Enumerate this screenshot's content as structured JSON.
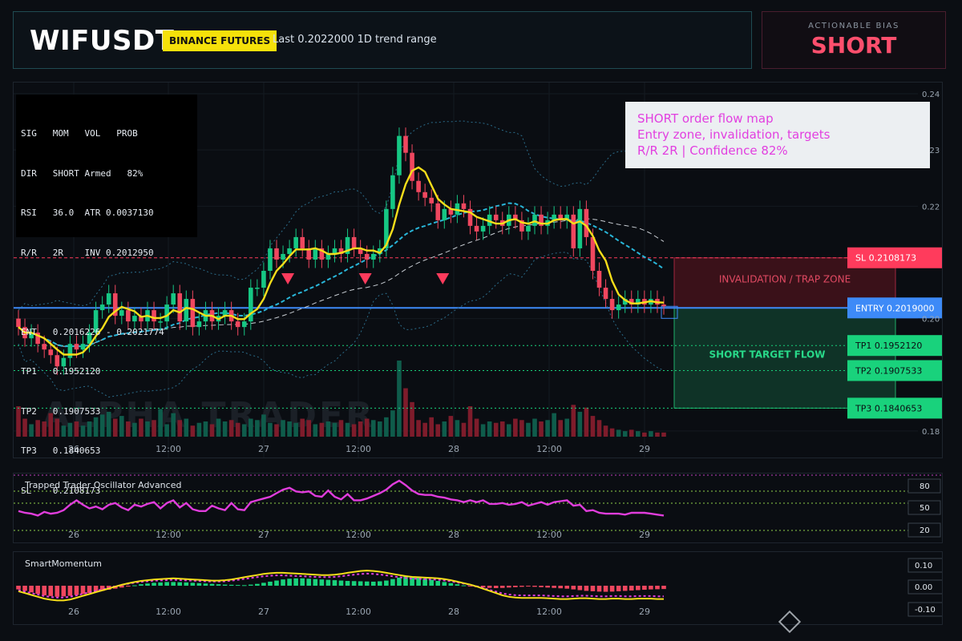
{
  "header": {
    "symbol": "WIFUSDT",
    "exchange_badge": "BINANCE FUTURES",
    "last_info": "Last 0.2022000   1D trend range"
  },
  "bias": {
    "label": "ACTIONABLE BIAS",
    "value": "SHORT"
  },
  "stats_panel": {
    "lines": [
      "SIG   MOM   VOL   PROB",
      "DIR   SHORT Armed   82%",
      "RSI   36.0  ATR 0.0037130",
      "R/R   2R    INV 0.2012950",
      "",
      "ENT   0.2016226 - 0.2021774",
      "TP1   0.1952120",
      "TP2   0.1907533",
      "TP3   0.1840653",
      "SL    0.2108173"
    ]
  },
  "note_box": {
    "lines": [
      "SHORT order flow map",
      "Entry zone, invalidation, targets",
      "R/R 2R | Confidence 82%"
    ]
  },
  "levels": [
    {
      "label": "SL 0.2108173",
      "value": 0.2108173,
      "color": "#ff3b5c",
      "text_color": "#ffffff"
    },
    {
      "label": "ENTRY 0.2019000",
      "value": 0.2019,
      "color": "#3d8af7",
      "text_color": "#ffffff"
    },
    {
      "label": "TP1 0.1952120",
      "value": 0.195212,
      "color": "#19d27c",
      "text_color": "#0b0e13"
    },
    {
      "label": "TP2 0.1907533",
      "value": 0.1907533,
      "color": "#19d27c",
      "text_color": "#0b0e13"
    },
    {
      "label": "TP3 0.1840653",
      "value": 0.1840653,
      "color": "#19d27c",
      "text_color": "#0b0e13"
    }
  ],
  "zones": {
    "invalidation": "INVALIDATION / TRAP ZONE",
    "target": "SHORT TARGET FLOW"
  },
  "watermark": "ALPHA TRADER",
  "chart_data": [
    {
      "type": "candlestick",
      "title": "WIFUSDT",
      "x_tick_labels": [
        "26",
        "12:00",
        "27",
        "12:00",
        "28",
        "12:00",
        "29"
      ],
      "ylim": [
        0.175,
        0.242
      ],
      "y_ticks": [
        0.18,
        0.2,
        0.22,
        0.23,
        0.24
      ],
      "y_tick_labels": [
        "0.18",
        "0.20",
        "0.22",
        "0.23",
        "0.24"
      ],
      "close": [
        0.1985,
        0.1965,
        0.1975,
        0.1955,
        0.1945,
        0.1935,
        0.1915,
        0.193,
        0.1955,
        0.1945,
        0.1955,
        0.1975,
        0.2015,
        0.2025,
        0.2045,
        0.2005,
        0.2015,
        0.1995,
        0.2005,
        0.1995,
        0.2015,
        0.1995,
        0.1995,
        0.2025,
        0.2045,
        0.1995,
        0.2035,
        0.1985,
        0.1995,
        0.2015,
        0.1995,
        0.2005,
        0.2015,
        0.1995,
        0.1985,
        0.1995,
        0.2055,
        0.2055,
        0.2085,
        0.2125,
        0.2105,
        0.2115,
        0.2125,
        0.2145,
        0.2125,
        0.2105,
        0.2125,
        0.2105,
        0.2115,
        0.2125,
        0.2115,
        0.2145,
        0.2125,
        0.2115,
        0.2105,
        0.2115,
        0.2125,
        0.2195,
        0.2255,
        0.2325,
        0.2295,
        0.2245,
        0.2225,
        0.2215,
        0.2205,
        0.2175,
        0.2195,
        0.2185,
        0.2205,
        0.2195,
        0.2165,
        0.2155,
        0.2165,
        0.2185,
        0.2175,
        0.2165,
        0.2185,
        0.2175,
        0.2155,
        0.2165,
        0.2185,
        0.2165,
        0.2175,
        0.2185,
        0.2175,
        0.2185,
        0.2125,
        0.2195,
        0.2145,
        0.2085,
        0.2055,
        0.2035,
        0.2015,
        0.2025,
        0.2035,
        0.2025,
        0.2035,
        0.2025,
        0.2035,
        0.2025,
        0.2022
      ],
      "open": [
        0.2,
        0.1985,
        0.1965,
        0.1975,
        0.1955,
        0.1945,
        0.1935,
        0.1915,
        0.193,
        0.1955,
        0.1945,
        0.1955,
        0.1975,
        0.2015,
        0.2025,
        0.2045,
        0.2005,
        0.2015,
        0.1995,
        0.2005,
        0.1995,
        0.2015,
        0.1995,
        0.1995,
        0.2025,
        0.2045,
        0.1995,
        0.2035,
        0.1985,
        0.1995,
        0.2015,
        0.1995,
        0.2005,
        0.2015,
        0.1995,
        0.1985,
        0.1995,
        0.2055,
        0.2055,
        0.2085,
        0.2125,
        0.2105,
        0.2115,
        0.2125,
        0.2145,
        0.2125,
        0.2105,
        0.2125,
        0.2105,
        0.2115,
        0.2125,
        0.2115,
        0.2145,
        0.2125,
        0.2115,
        0.2105,
        0.2115,
        0.2125,
        0.2195,
        0.2255,
        0.2325,
        0.2295,
        0.2245,
        0.2225,
        0.2215,
        0.2205,
        0.2175,
        0.2195,
        0.2185,
        0.2205,
        0.2195,
        0.2165,
        0.2155,
        0.2165,
        0.2185,
        0.2175,
        0.2165,
        0.2185,
        0.2175,
        0.2155,
        0.2165,
        0.2185,
        0.2165,
        0.2175,
        0.2185,
        0.2175,
        0.2185,
        0.2125,
        0.2195,
        0.2145,
        0.2085,
        0.2055,
        0.2035,
        0.2015,
        0.2025,
        0.2035,
        0.2025,
        0.2035,
        0.2025,
        0.2035,
        0.2025
      ],
      "volume": [
        22,
        13,
        9,
        12,
        11,
        17,
        13,
        8,
        10,
        11,
        8,
        11,
        14,
        16,
        18,
        13,
        15,
        11,
        10,
        13,
        11,
        12,
        20,
        9,
        17,
        12,
        13,
        8,
        10,
        11,
        9,
        13,
        11,
        12,
        10,
        9,
        13,
        12,
        16,
        10,
        9,
        12,
        11,
        10,
        13,
        12,
        9,
        10,
        11,
        10,
        12,
        10,
        9,
        11,
        13,
        12,
        11,
        14,
        19,
        55,
        35,
        25,
        12,
        10,
        14,
        9,
        11,
        15,
        12,
        10,
        22,
        13,
        9,
        11,
        10,
        11,
        9,
        13,
        12,
        10,
        13,
        11,
        12,
        17,
        12,
        13,
        23,
        18,
        21,
        15,
        12,
        8,
        6,
        5,
        4,
        5,
        4,
        3,
        4,
        3,
        3
      ]
    },
    {
      "type": "line",
      "title": "Trapped Trader Oscillator Advanced",
      "x_tick_labels": [
        "26",
        "12:00",
        "27",
        "12:00",
        "28",
        "12:00",
        "29"
      ],
      "y_tick_labels": [
        "80",
        "50",
        "20"
      ],
      "series": [
        {
          "values": [
            48,
            46,
            45,
            43,
            47,
            45,
            46,
            49,
            55,
            60,
            55,
            51,
            53,
            50,
            55,
            57,
            52,
            49,
            55,
            53,
            56,
            58,
            51,
            57,
            60,
            52,
            57,
            50,
            48,
            48,
            54,
            51,
            49,
            57,
            50,
            49,
            58,
            60,
            62,
            64,
            68,
            72,
            74,
            70,
            69,
            70,
            65,
            64,
            71,
            64,
            61,
            67,
            60,
            60,
            62,
            65,
            68,
            72,
            78,
            82,
            77,
            71,
            67,
            66,
            66,
            64,
            63,
            61,
            60,
            58,
            60,
            58,
            60,
            56,
            56,
            57,
            55,
            56,
            58,
            54,
            56,
            58,
            55,
            58,
            59,
            60,
            54,
            55,
            48,
            49,
            46,
            45,
            45,
            45,
            44,
            46,
            46,
            46,
            45,
            44,
            43
          ]
        }
      ]
    },
    {
      "type": "bar",
      "title": "SmartMomentum",
      "x_tick_labels": [
        "26",
        "12:00",
        "27",
        "12:00",
        "28",
        "12:00",
        "29"
      ],
      "y_tick_labels": [
        "0.10",
        "0.00",
        "-0.10"
      ],
      "values": [
        -0.02,
        -0.028,
        -0.036,
        -0.044,
        -0.052,
        -0.056,
        -0.06,
        -0.058,
        -0.055,
        -0.05,
        -0.045,
        -0.04,
        -0.034,
        -0.028,
        -0.022,
        -0.016,
        -0.01,
        -0.004,
        0.002,
        0.008,
        0.012,
        0.016,
        0.018,
        0.02,
        0.02,
        0.019,
        0.018,
        0.016,
        0.014,
        0.012,
        0.01,
        0.008,
        0.006,
        0.005,
        0.004,
        0.003,
        0.006,
        0.01,
        0.016,
        0.022,
        0.028,
        0.034,
        0.038,
        0.04,
        0.04,
        0.038,
        0.036,
        0.034,
        0.032,
        0.03,
        0.028,
        0.026,
        0.025,
        0.024,
        0.023,
        0.022,
        0.024,
        0.028,
        0.036,
        0.044,
        0.05,
        0.048,
        0.044,
        0.038,
        0.032,
        0.026,
        0.02,
        0.014,
        0.008,
        0.002,
        -0.004,
        -0.008,
        -0.01,
        -0.012,
        -0.013,
        -0.012,
        -0.01,
        -0.008,
        -0.006,
        -0.004,
        -0.006,
        -0.008,
        -0.01,
        -0.012,
        -0.014,
        -0.016,
        -0.02,
        -0.024,
        -0.028,
        -0.03,
        -0.032,
        -0.033,
        -0.032,
        -0.03,
        -0.028,
        -0.026,
        -0.024,
        -0.022,
        -0.02,
        -0.019,
        -0.018
      ],
      "signal": [
        -0.03,
        -0.04,
        -0.05,
        -0.06,
        -0.07,
        -0.076,
        -0.08,
        -0.08,
        -0.075,
        -0.065,
        -0.055,
        -0.045,
        -0.035,
        -0.025,
        -0.015,
        -0.005,
        0.005,
        0.013,
        0.02,
        0.026,
        0.03,
        0.034,
        0.036,
        0.038,
        0.04,
        0.038,
        0.036,
        0.034,
        0.032,
        0.03,
        0.028,
        0.028,
        0.03,
        0.034,
        0.04,
        0.046,
        0.052,
        0.058,
        0.064,
        0.068,
        0.07,
        0.07,
        0.068,
        0.066,
        0.064,
        0.062,
        0.06,
        0.058,
        0.058,
        0.06,
        0.064,
        0.07,
        0.075,
        0.08,
        0.082,
        0.08,
        0.076,
        0.07,
        0.064,
        0.058,
        0.052,
        0.048,
        0.046,
        0.044,
        0.042,
        0.04,
        0.036,
        0.03,
        0.022,
        0.014,
        0.006,
        -0.004,
        -0.016,
        -0.028,
        -0.04,
        -0.052,
        -0.06,
        -0.064,
        -0.066,
        -0.066,
        -0.066,
        -0.066,
        -0.068,
        -0.07,
        -0.072,
        -0.072,
        -0.07,
        -0.068,
        -0.068,
        -0.07,
        -0.072,
        -0.072,
        -0.07,
        -0.07,
        -0.072,
        -0.072,
        -0.07,
        -0.07,
        -0.07,
        -0.072,
        -0.072
      ]
    }
  ]
}
